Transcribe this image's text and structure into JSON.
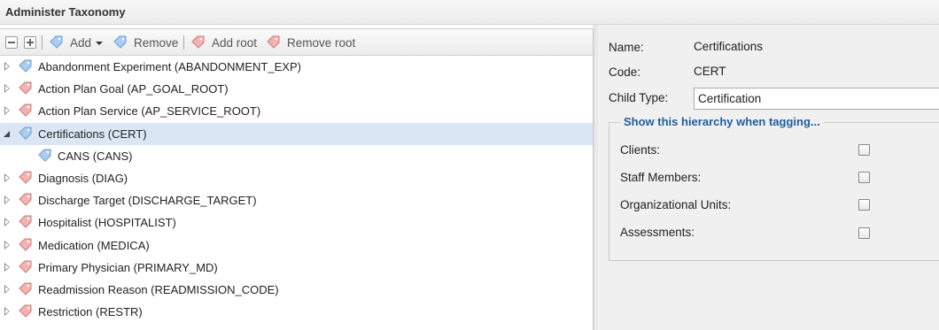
{
  "window": {
    "title": "Administer Taxonomy"
  },
  "toolbar": {
    "add_label": "Add",
    "remove_label": "Remove",
    "add_root_label": "Add root",
    "remove_root_label": "Remove root"
  },
  "tree": {
    "nodes": [
      {
        "label": "Abandonment Experiment (ABANDONMENT_EXP)",
        "state": "collapsed"
      },
      {
        "label": "Action Plan Goal (AP_GOAL_ROOT)",
        "state": "collapsed"
      },
      {
        "label": "Action Plan Service (AP_SERVICE_ROOT)",
        "state": "collapsed"
      },
      {
        "label": "Certifications (CERT)",
        "state": "expanded",
        "selected": true
      },
      {
        "label": "CANS (CANS)",
        "state": "leaf",
        "child": true
      },
      {
        "label": "Diagnosis (DIAG)",
        "state": "collapsed"
      },
      {
        "label": "Discharge Target (DISCHARGE_TARGET)",
        "state": "collapsed"
      },
      {
        "label": "Hospitalist (HOSPITALIST)",
        "state": "collapsed"
      },
      {
        "label": "Medication (MEDICA)",
        "state": "collapsed"
      },
      {
        "label": "Primary Physician (PRIMARY_MD)",
        "state": "collapsed"
      },
      {
        "label": "Readmission Reason (READMISSION_CODE)",
        "state": "collapsed"
      },
      {
        "label": "Restriction (RESTR)",
        "state": "collapsed"
      }
    ]
  },
  "details": {
    "name_label": "Name:",
    "name_value": "Certifications",
    "code_label": "Code:",
    "code_value": "CERT",
    "child_type_label": "Child Type:",
    "child_type_value": "Certification",
    "hierarchy_legend": "Show this hierarchy when tagging...",
    "options": [
      {
        "label": "Clients:",
        "checked": false
      },
      {
        "label": "Staff Members:",
        "checked": false
      },
      {
        "label": "Organizational Units:",
        "checked": false
      },
      {
        "label": "Assessments:",
        "checked": false
      }
    ]
  },
  "colors": {
    "selected_row": "#dbe6f5",
    "legend_text": "#1f5d9c",
    "tag_blue": "#7fb2e5",
    "tag_red": "#e58080"
  },
  "icons": {
    "collapse_all": "minus-box-icon",
    "expand_all": "plus-box-icon",
    "tag": "tag-icon"
  }
}
